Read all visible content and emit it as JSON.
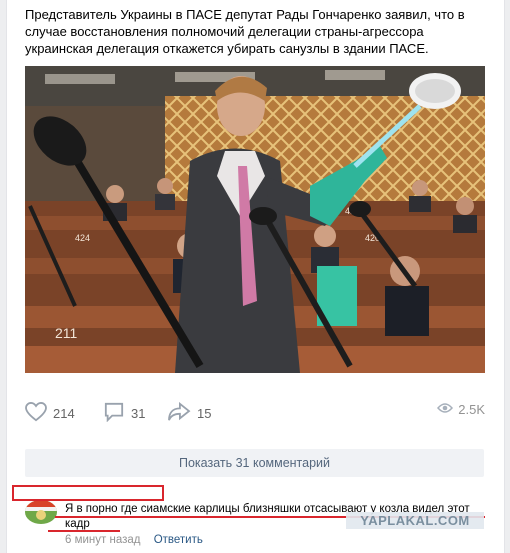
{
  "post": {
    "text": "Представитель Украины в ПАСЕ депутат Рады Гончаренко заявил, что в случае восстановления полномочий делегации страны-агрессора украинская делегация откажется убирать санузлы в здании ПАСЕ."
  },
  "actions": {
    "likes": "214",
    "comments": "31",
    "shares": "15",
    "views": "2.5K"
  },
  "show_comments": "Показать 31 комментарий",
  "comment": {
    "text": "Я в порно где сиамские карлицы близняшки отсасывают у козла видел этот кадр",
    "time": "6 минут назад",
    "reply_label": "Ответить"
  },
  "watermark": "YAPLAKAL.COM",
  "photo": {
    "seat_numbers": [
      "416",
      "420",
      "424",
      "211"
    ]
  },
  "icons": {
    "like": "heart-icon",
    "comment": "comment-icon",
    "share": "share-icon",
    "views": "eye-icon"
  },
  "colors": {
    "link": "#2a5885",
    "highlight": "#d9262d",
    "background": "#edeef0"
  }
}
